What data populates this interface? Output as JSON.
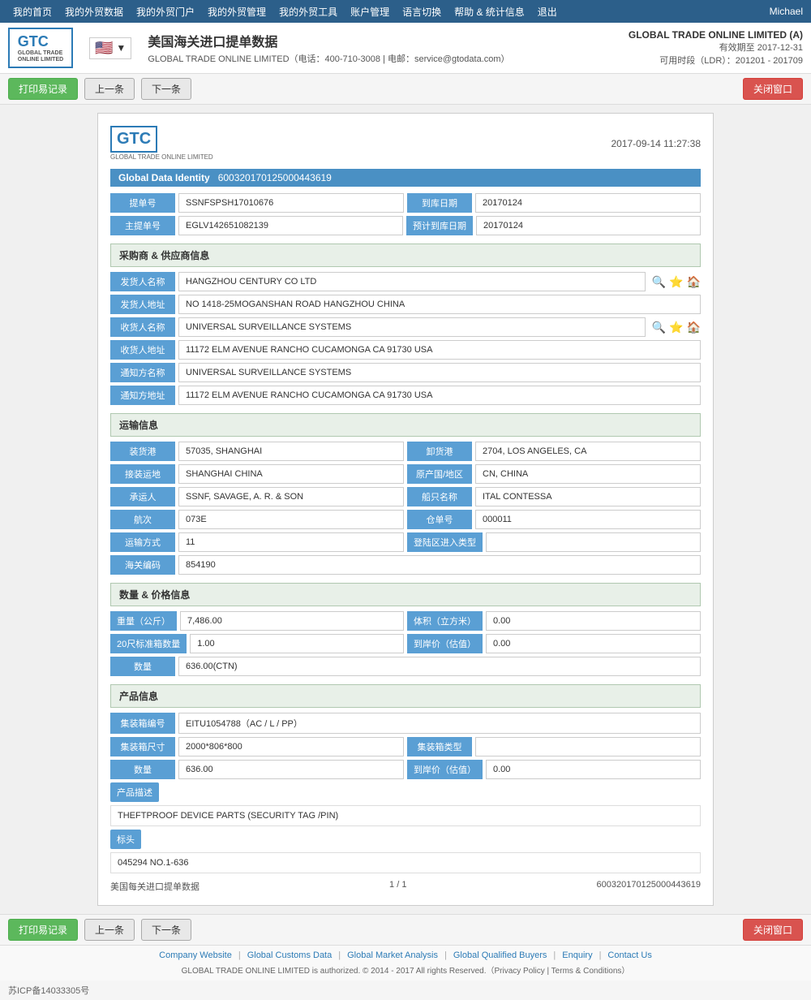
{
  "topnav": {
    "items": [
      {
        "label": "我的首页",
        "id": "home"
      },
      {
        "label": "我的外贸数据",
        "id": "trade-data"
      },
      {
        "label": "我的外贸门户",
        "id": "trade-portal"
      },
      {
        "label": "我的外贸管理",
        "id": "trade-mgmt"
      },
      {
        "label": "我的外贸工具",
        "id": "trade-tools"
      },
      {
        "label": "账户管理",
        "id": "account"
      },
      {
        "label": "语言切换",
        "id": "language"
      },
      {
        "label": "帮助 & 统计信息",
        "id": "help"
      },
      {
        "label": "退出",
        "id": "logout"
      }
    ],
    "user": "Michael"
  },
  "header": {
    "logo": "GTC",
    "logo_sub": "GLOBAL TRADE ONLINE LIMITED",
    "flag": "🇺🇸",
    "title": "美国海关进口提单数据",
    "subtitle_label": "GLOBAL TRADE ONLINE LIMITED（电话：400-710-3008 | 电邮：service@gtodata.com）",
    "company": "GLOBAL TRADE ONLINE LIMITED (A)",
    "expiry_label": "有效期至",
    "expiry_date": "2017-12-31",
    "time_label": "可用时段（LDR）：201201 - 201709"
  },
  "toolbar": {
    "print_label": "打印易记录",
    "prev_label": "上一条",
    "next_label": "下一条",
    "close_label": "关闭窗口"
  },
  "document": {
    "timestamp": "2017-09-14 11:27:38",
    "global_data_identity_label": "Global Data Identity",
    "global_data_identity_value": "600320170125000443619",
    "fields": {
      "提单号_label": "提单号",
      "提单号_value": "SSNFSPSH17010676",
      "到库日期_label": "到库日期",
      "到库日期_value": "20170124",
      "主提单号_label": "主提单号",
      "主提单号_value": "EGLV142651082139",
      "预计到库日期_label": "预计到库日期",
      "预计到库日期_value": "20170124"
    },
    "sections": {
      "buyer_supplier": {
        "title": "采购商 & 供应商信息",
        "fields": [
          {
            "label": "发货人名称",
            "value": "HANGZHOU CENTURY CO LTD",
            "has_icons": true
          },
          {
            "label": "发货人地址",
            "value": "NO 1418-25MOGANSHAN ROAD HANGZHOU CHINA",
            "has_icons": false
          },
          {
            "label": "收货人名称",
            "value": "UNIVERSAL SURVEILLANCE SYSTEMS",
            "has_icons": true
          },
          {
            "label": "收货人地址",
            "value": "11172 ELM AVENUE RANCHO CUCAMONGA CA 91730 USA",
            "has_icons": false
          },
          {
            "label": "通知方名称",
            "value": "UNIVERSAL SURVEILLANCE SYSTEMS",
            "has_icons": false
          },
          {
            "label": "通知方地址",
            "value": "11172 ELM AVENUE RANCHO CUCAMONGA CA 91730 USA",
            "has_icons": false
          }
        ]
      },
      "transport": {
        "title": "运输信息",
        "rows": [
          {
            "left": {
              "label": "装货港",
              "value": "57035, SHANGHAI"
            },
            "right": {
              "label": "卸货港",
              "value": "2704, LOS ANGELES, CA"
            }
          },
          {
            "left": {
              "label": "接装运地",
              "value": "SHANGHAI CHINA"
            },
            "right": {
              "label": "原产国/地区",
              "value": "CN, CHINA"
            }
          },
          {
            "left": {
              "label": "承运人",
              "value": "SSNF, SAVAGE, A. R. & SON"
            },
            "right": {
              "label": "船只名称",
              "value": "ITAL CONTESSA"
            }
          },
          {
            "left": {
              "label": "航次",
              "value": "073E"
            },
            "right": {
              "label": "仓单号",
              "value": "000011"
            }
          },
          {
            "left": {
              "label": "运输方式",
              "value": "11"
            },
            "right": {
              "label": "登陆区进入类型",
              "value": ""
            }
          },
          {
            "left": {
              "label": "海关编码",
              "value": "854190"
            },
            "right": null
          }
        ]
      },
      "quantity_price": {
        "title": "数量 & 价格信息",
        "rows": [
          {
            "left": {
              "label": "重量（公斤）",
              "value": "7,486.00"
            },
            "right": {
              "label": "体积（立方米）",
              "value": "0.00"
            }
          },
          {
            "left": {
              "label": "20尺标准箱数量",
              "value": "1.00"
            },
            "right": {
              "label": "到岸价（估值）",
              "value": "0.00"
            }
          },
          {
            "left": {
              "label": "数量",
              "value": "636.00(CTN)"
            },
            "right": null
          }
        ]
      },
      "product": {
        "title": "产品信息",
        "container_no_label": "集装箱编号",
        "container_no_value": "EITU1054788（AC / L / PP）",
        "container_size_label": "集装箱尺寸",
        "container_size_value": "2000*806*800",
        "container_type_label": "集装箱类型",
        "container_type_value": "",
        "quantity_label": "数量",
        "quantity_value": "636.00",
        "arrival_price_label": "到岸价（估值）",
        "arrival_price_value": "0.00",
        "description_label": "产品描述",
        "description_value": "THEFTPROOF DEVICE PARTS (SECURITY TAG /PIN)",
        "marks_label": "标头",
        "marks_value": "045294 NO.1-636"
      }
    },
    "pagination": {
      "doc_label": "美国每关进口提单数据",
      "page": "1 / 1",
      "doc_id": "600320170125000443619"
    }
  },
  "footer": {
    "links": [
      {
        "label": "Company Website",
        "id": "company-website"
      },
      {
        "label": "Global Customs Data",
        "id": "global-customs"
      },
      {
        "label": "Global Market Analysis",
        "id": "global-market"
      },
      {
        "label": "Global Qualified Buyers",
        "id": "global-buyers"
      },
      {
        "label": "Enquiry",
        "id": "enquiry"
      },
      {
        "label": "Contact Us",
        "id": "contact-us"
      }
    ],
    "copyright": "GLOBAL TRADE ONLINE LIMITED is authorized. © 2014 - 2017 All rights Reserved.（Privacy Policy | Terms & Conditions）",
    "icp": "苏ICP备14033305号"
  }
}
